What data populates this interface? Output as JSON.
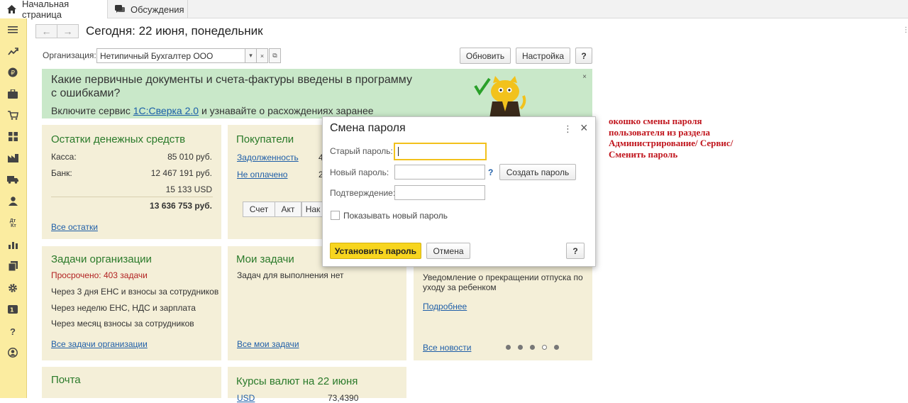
{
  "tabs": {
    "home": "Начальная страница",
    "discussions": "Обсуждения"
  },
  "header": {
    "title": "Сегодня: 22 июня, понедельник"
  },
  "org": {
    "label": "Организация:",
    "value": "Нетипичный Бухгалтер ООО"
  },
  "toolbar": {
    "refresh": "Обновить",
    "settings": "Настройка",
    "help": "?"
  },
  "banner": {
    "question": "Какие первичные документы и счета-фактуры введены в программу с ошибками?",
    "sub_before": "Включите сервис ",
    "sub_link": "1С:Сверка 2.0",
    "sub_after": " и узнавайте о расхождениях заранее",
    "close": "×"
  },
  "cash": {
    "title": "Остатки денежных средств",
    "kassa_label": "Касса:",
    "kassa_value": "85 010 руб.",
    "bank_label": "Банк:",
    "bank_value": "12 467 191 руб.",
    "usd_value": "15 133 USD",
    "total": "13 636 753 руб.",
    "all_link": "Все остатки"
  },
  "buyers": {
    "title": "Покупатели",
    "debt_link": "Задолженность",
    "debt_value": "4",
    "unpaid_link": "Не оплачено",
    "unpaid_value": "2",
    "seg": [
      "Счет",
      "Акт",
      "Нак"
    ]
  },
  "org_tasks": {
    "title": "Задачи организации",
    "overdue": "Просрочено: 403 задачи",
    "items": [
      "Через 3 дня ЕНС и взносы за сотрудников",
      "Через неделю ЕНС, НДС и зарплата",
      "Через месяц взносы за сотрудников"
    ],
    "all_link": "Все задачи организации"
  },
  "my_tasks": {
    "title": "Мои задачи",
    "empty": "Задач для выполнения нет",
    "all_link": "Все мои задачи"
  },
  "news": {
    "text1": "Уведомление о прекращении отпуска по",
    "text2": "уходу за ребенком",
    "more_link": "Подробнее",
    "all_link": "Все новости"
  },
  "mail": {
    "title": "Почта"
  },
  "rates": {
    "title": "Курсы валют на 22 июня",
    "currency": "USD",
    "value": "73,4390"
  },
  "dialog": {
    "title": "Смена пароля",
    "old_label": "Старый пароль:",
    "new_label": "Новый пароль:",
    "confirm_label": "Подтверждение:",
    "create_button": "Создать пароль",
    "q_mark": "?",
    "show_checkbox": "Показывать новый пароль",
    "set_button": "Установить пароль",
    "cancel_button": "Отмена",
    "help_button": "?",
    "menu_icon": "⋮",
    "close_icon": "×"
  },
  "annotation": {
    "lines": [
      "окошко смены пароля",
      "пользователя из раздела",
      "Администрирование/ Сервис/",
      "Сменить пароль"
    ]
  },
  "colors": {
    "sidebar": "#fbeca0",
    "banner": "#c9e8c9",
    "tile": "#f4efd8",
    "tile_title": "#2a7a2a",
    "primary_button": "#f7d51f",
    "annotation": "#c0141c"
  }
}
